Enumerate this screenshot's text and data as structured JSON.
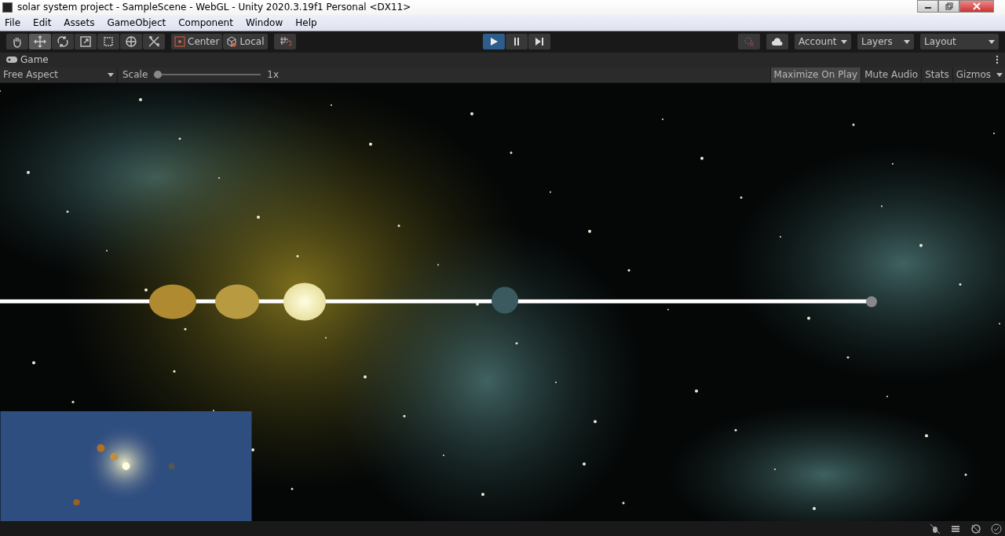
{
  "window": {
    "title": "solar system project - SampleScene - WebGL - Unity 2020.3.19f1 Personal <DX11>"
  },
  "menu": [
    "File",
    "Edit",
    "Assets",
    "GameObject",
    "Component",
    "Window",
    "Help"
  ],
  "tools": [
    {
      "kind": "hand",
      "selected": false
    },
    {
      "kind": "move",
      "selected": true
    },
    {
      "kind": "rotate",
      "selected": false
    },
    {
      "kind": "scale",
      "selected": false
    },
    {
      "kind": "rect",
      "selected": false
    },
    {
      "kind": "transform",
      "selected": false
    },
    {
      "kind": "custom",
      "selected": false
    }
  ],
  "pivot": [
    {
      "kind": "center",
      "label": "Center"
    },
    {
      "kind": "local",
      "label": "Local"
    }
  ],
  "playback": [
    {
      "kind": "play",
      "selected": true
    },
    {
      "kind": "pause",
      "selected": false
    },
    {
      "kind": "step",
      "selected": false
    }
  ],
  "dropdowns": [
    "Account",
    "Layers",
    "Layout"
  ],
  "game_tab": {
    "label": "Game"
  },
  "game_bar": {
    "aspect": "Free Aspect",
    "scale_label": "Scale",
    "scale": {
      "level": 0
    },
    "scale_value": "1x",
    "toggles": [
      {
        "label": "Maximize On Play",
        "selected": true
      },
      {
        "label": "Mute Audio",
        "selected": false
      },
      {
        "label": "Stats",
        "selected": false
      },
      {
        "label": "Gizmos",
        "selected": false
      }
    ]
  },
  "game_view": {
    "kind": "picture"
  },
  "status_icons": [
    {
      "kind": "bug"
    },
    {
      "kind": "stack"
    },
    {
      "kind": "sync"
    },
    {
      "kind": "check"
    }
  ]
}
